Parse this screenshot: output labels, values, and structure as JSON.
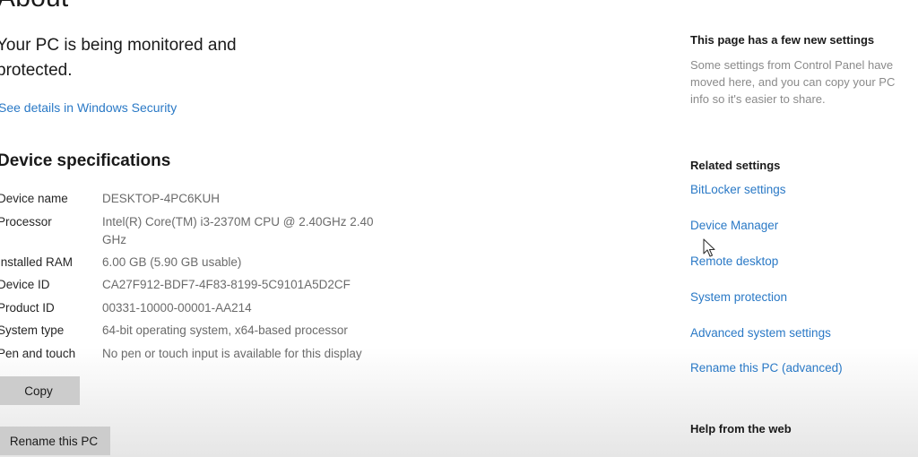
{
  "page": {
    "title": "About"
  },
  "security": {
    "status_text": "Your PC is being monitored and protected.",
    "link_label": "See details in Windows Security"
  },
  "device_specifications": {
    "title": "Device specifications",
    "rows": [
      {
        "label": "Device name",
        "value": "DESKTOP-4PC6KUH"
      },
      {
        "label": "Processor",
        "value": "Intel(R) Core(TM) i3-2370M CPU @ 2.40GHz   2.40 GHz"
      },
      {
        "label": "Installed RAM",
        "value": "6.00 GB (5.90 GB usable)"
      },
      {
        "label": "Device ID",
        "value": "CA27F912-BDF7-4F83-8199-5C9101A5D2CF"
      },
      {
        "label": "Product ID",
        "value": "00331-10000-00001-AA214"
      },
      {
        "label": "System type",
        "value": "64-bit operating system, x64-based processor"
      },
      {
        "label": "Pen and touch",
        "value": "No pen or touch input is available for this display"
      }
    ],
    "copy_button": "Copy",
    "rename_button": "Rename this PC"
  },
  "sidebar": {
    "notice_title": "This page has a few new settings",
    "notice_text": "Some settings from Control Panel have moved here, and you can copy your PC info so it's easier to share.",
    "related_title": "Related settings",
    "related_links": [
      {
        "label": "BitLocker settings"
      },
      {
        "label": "Device Manager"
      },
      {
        "label": "Remote desktop"
      },
      {
        "label": "System protection"
      },
      {
        "label": "Advanced system settings"
      },
      {
        "label": "Rename this PC (advanced)"
      }
    ],
    "help_title": "Help from the web"
  },
  "colors": {
    "link": "#2a79c6",
    "button_bg": "#cccccc",
    "secondary_text": "#6b6b6b"
  }
}
